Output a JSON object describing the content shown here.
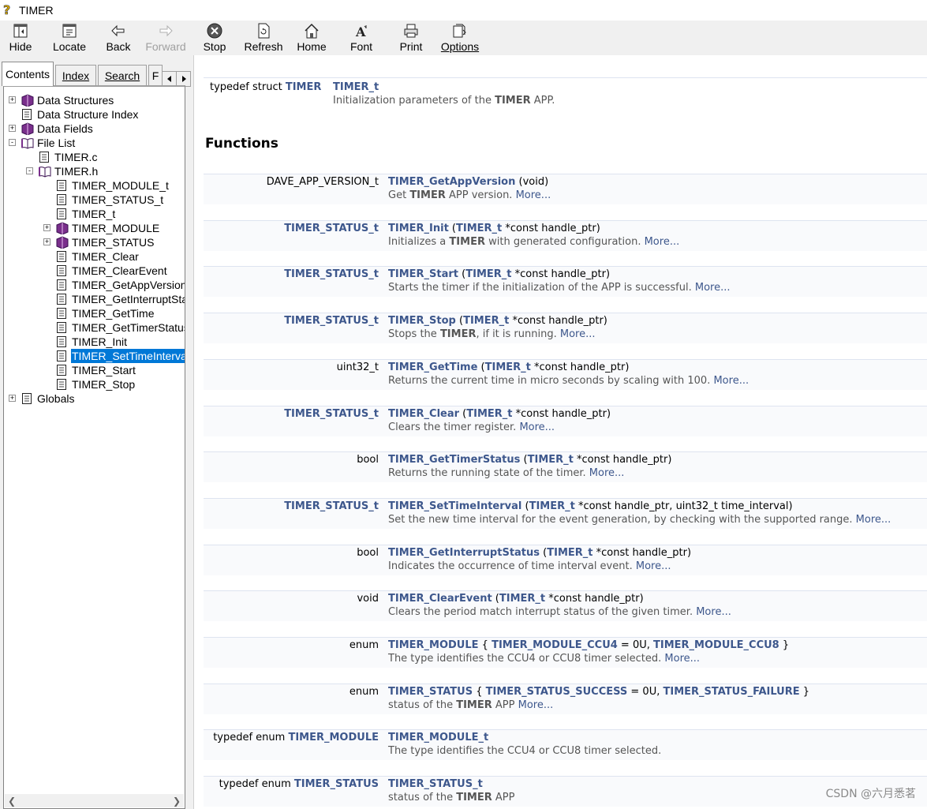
{
  "window": {
    "title": "TIMER",
    "icon": "help-question-icon"
  },
  "toolbar": {
    "hide": "Hide",
    "locate": "Locate",
    "back": "Back",
    "forward": "Forward",
    "stop": "Stop",
    "refresh": "Refresh",
    "home": "Home",
    "font": "Font",
    "print": "Print",
    "options": "Options"
  },
  "tabs": {
    "contents": "Contents",
    "index": "Index",
    "search": "Search",
    "fav": "F"
  },
  "tree": [
    {
      "label": "Data Structures",
      "icon": "book-icon",
      "expander": "+"
    },
    {
      "label": "Data Structure Index",
      "icon": "page-icon",
      "expander": ""
    },
    {
      "label": "Data Fields",
      "icon": "book-icon",
      "expander": "+"
    },
    {
      "label": "File List",
      "icon": "open-book-icon",
      "expander": "-"
    },
    {
      "label": "TIMER.c",
      "icon": "page-icon",
      "expander": ""
    },
    {
      "label": "TIMER.h",
      "icon": "open-book-icon",
      "expander": "-"
    },
    {
      "label": "TIMER_MODULE_t",
      "icon": "page-icon",
      "expander": ""
    },
    {
      "label": "TIMER_STATUS_t",
      "icon": "page-icon",
      "expander": ""
    },
    {
      "label": "TIMER_t",
      "icon": "page-icon",
      "expander": ""
    },
    {
      "label": "TIMER_MODULE",
      "icon": "book-icon",
      "expander": "+"
    },
    {
      "label": "TIMER_STATUS",
      "icon": "book-icon",
      "expander": "+"
    },
    {
      "label": "TIMER_Clear",
      "icon": "page-icon",
      "expander": ""
    },
    {
      "label": "TIMER_ClearEvent",
      "icon": "page-icon",
      "expander": ""
    },
    {
      "label": "TIMER_GetAppVersion",
      "icon": "page-icon",
      "expander": ""
    },
    {
      "label": "TIMER_GetInterruptStatus",
      "icon": "page-icon",
      "expander": ""
    },
    {
      "label": "TIMER_GetTime",
      "icon": "page-icon",
      "expander": ""
    },
    {
      "label": "TIMER_GetTimerStatus",
      "icon": "page-icon",
      "expander": ""
    },
    {
      "label": "TIMER_Init",
      "icon": "page-icon",
      "expander": ""
    },
    {
      "label": "TIMER_SetTimeInterval",
      "icon": "page-icon",
      "expander": ""
    },
    {
      "label": "TIMER_Start",
      "icon": "page-icon",
      "expander": ""
    },
    {
      "label": "TIMER_Stop",
      "icon": "page-icon",
      "expander": ""
    },
    {
      "label": "Globals",
      "icon": "page-icon",
      "expander": "+"
    }
  ],
  "selected_tree_item": "TIMER_SetTimeInterval",
  "content": {
    "typedef_row": {
      "left_prefix": "typedef struct ",
      "left_link": "TIMER",
      "name": "TIMER_t",
      "desc_prefix": "Initialization parameters of the ",
      "desc_bold": "TIMER",
      "desc_suffix": " APP."
    },
    "functions_heading": "Functions",
    "more": "More...",
    "functions": [
      {
        "ret": "DAVE_APP_VERSION_t",
        "ret_link": false,
        "name": "TIMER_GetAppVersion",
        "args": " (void)",
        "desc": "Get TIMER APP version. ",
        "more": true
      },
      {
        "ret": "TIMER_STATUS_t",
        "ret_link": true,
        "name": "TIMER_Init",
        "args": " (TIMER_t *const handle_ptr)",
        "desc": "Initializes a TIMER with generated configuration. ",
        "more": true
      },
      {
        "ret": "TIMER_STATUS_t",
        "ret_link": true,
        "name": "TIMER_Start",
        "args": " (TIMER_t *const handle_ptr)",
        "desc": "Starts the timer if the initialization of the APP is successful. ",
        "more": true
      },
      {
        "ret": "TIMER_STATUS_t",
        "ret_link": true,
        "name": "TIMER_Stop",
        "args": " (TIMER_t *const handle_ptr)",
        "desc": "Stops the TIMER, if it is running. ",
        "more": true
      },
      {
        "ret": "uint32_t",
        "ret_link": false,
        "name": "TIMER_GetTime",
        "args": " (TIMER_t *const handle_ptr)",
        "desc": "Returns the current time in micro seconds by scaling with 100. ",
        "more": true
      },
      {
        "ret": "TIMER_STATUS_t",
        "ret_link": true,
        "name": "TIMER_Clear",
        "args": " (TIMER_t *const handle_ptr)",
        "desc": "Clears the timer register. ",
        "more": true
      },
      {
        "ret": "bool",
        "ret_link": false,
        "name": "TIMER_GetTimerStatus",
        "args": " (TIMER_t *const handle_ptr)",
        "desc": "Returns the running state of the timer. ",
        "more": true
      },
      {
        "ret": "TIMER_STATUS_t",
        "ret_link": true,
        "name": "TIMER_SetTimeInterval",
        "args": " (TIMER_t *const handle_ptr, uint32_t time_interval)",
        "desc": "Set the new time interval for the event generation, by checking with the supported range. ",
        "more": true
      },
      {
        "ret": "bool",
        "ret_link": false,
        "name": "TIMER_GetInterruptStatus",
        "args": " (TIMER_t *const handle_ptr)",
        "desc": "Indicates the occurrence of time interval event. ",
        "more": true
      },
      {
        "ret": "void",
        "ret_link": false,
        "name": "TIMER_ClearEvent",
        "args": " (TIMER_t *const handle_ptr)",
        "desc": "Clears the period match interrupt status of the given timer. ",
        "more": true
      },
      {
        "ret": "enum",
        "ret_link": false,
        "name": "TIMER_MODULE",
        "args": " { TIMER_MODULE_CCU4 = 0U, TIMER_MODULE_CCU8 }",
        "desc": "The type identifies the CCU4 or CCU8 timer selected. ",
        "more": true
      },
      {
        "ret": "enum",
        "ret_link": false,
        "name": "TIMER_STATUS",
        "args": " { TIMER_STATUS_SUCCESS = 0U, TIMER_STATUS_FAILURE }",
        "desc": "status of the TIMER APP ",
        "more": true
      },
      {
        "ret": "typedef enum TIMER_MODULE",
        "ret_link": false,
        "name": "TIMER_MODULE_t",
        "args": "",
        "desc": "The type identifies the CCU4 or CCU8 timer selected.",
        "more": false
      },
      {
        "ret": "typedef enum TIMER_STATUS",
        "ret_link": false,
        "name": "TIMER_STATUS_t",
        "args": "",
        "desc": "status of the TIMER APP",
        "more": false
      }
    ]
  },
  "watermark": "CSDN @六月悉茗",
  "colors": {
    "link": "#3d578c",
    "row_bg": "#f9fafc",
    "row_border": "#dee4f0",
    "selection": "#0078d7"
  }
}
